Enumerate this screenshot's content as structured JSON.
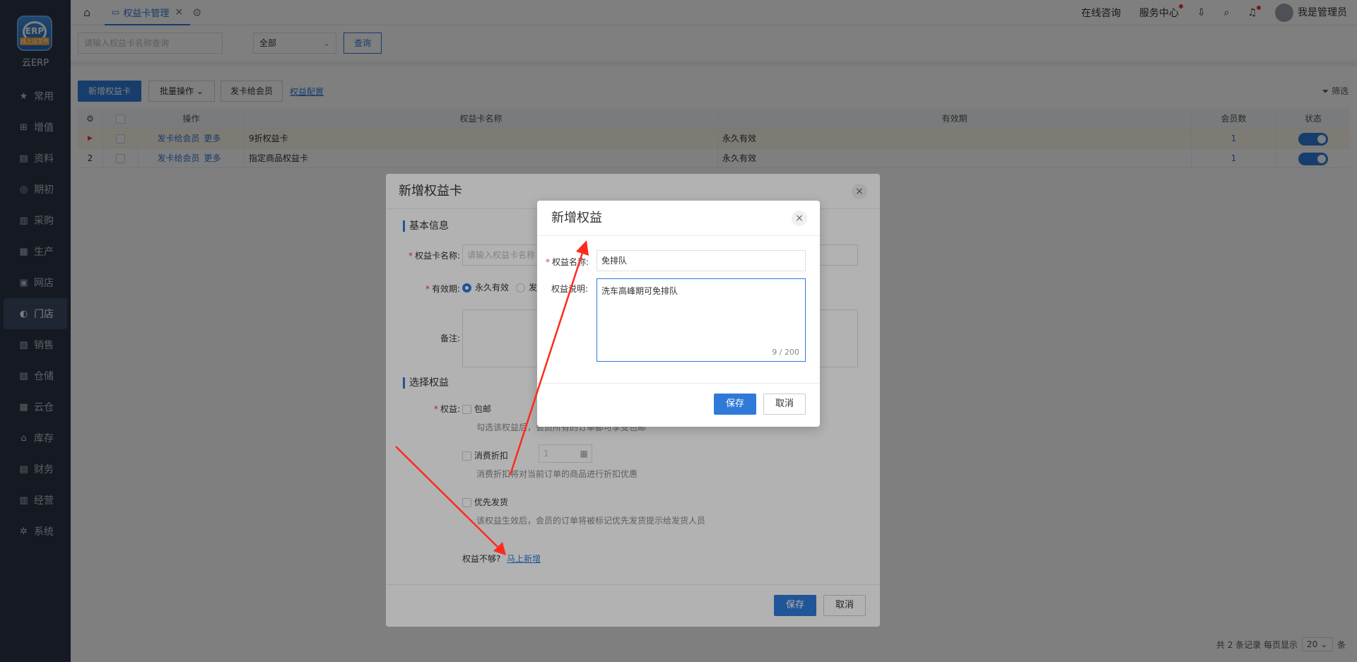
{
  "sidebar": {
    "logo_band": "线上没文件",
    "logo_text": "云ERP",
    "items": [
      {
        "label": "常用",
        "icon": "star-icon",
        "glyph": "★"
      },
      {
        "label": "增值",
        "icon": "plus-box-icon",
        "glyph": "⊞"
      },
      {
        "label": "资料",
        "icon": "document-icon",
        "glyph": "▤"
      },
      {
        "label": "期初",
        "icon": "clock-icon",
        "glyph": "◎"
      },
      {
        "label": "采购",
        "icon": "cart-icon",
        "glyph": "▥"
      },
      {
        "label": "生产",
        "icon": "factory-icon",
        "glyph": "▦"
      },
      {
        "label": "网店",
        "icon": "shop-icon",
        "glyph": "▣"
      },
      {
        "label": "门店",
        "icon": "store-icon",
        "glyph": "◐"
      },
      {
        "label": "销售",
        "icon": "chart-icon",
        "glyph": "▨"
      },
      {
        "label": "仓储",
        "icon": "warehouse-icon",
        "glyph": "▧"
      },
      {
        "label": "云仓",
        "icon": "cloud-warehouse-icon",
        "glyph": "▩"
      },
      {
        "label": "库存",
        "icon": "inventory-icon",
        "glyph": "⌂"
      },
      {
        "label": "财务",
        "icon": "finance-icon",
        "glyph": "▤"
      },
      {
        "label": "经营",
        "icon": "business-icon",
        "glyph": "▥"
      },
      {
        "label": "系统",
        "icon": "gear-icon",
        "glyph": "✲"
      }
    ]
  },
  "topbar": {
    "tab_label": "权益卡管理",
    "online_consult": "在线咨询",
    "service_center": "服务中心",
    "user_name": "我是管理员"
  },
  "search": {
    "placeholder": "请输入权益卡名称查询",
    "select_value": "全部",
    "query_label": "查询"
  },
  "toolbar": {
    "add_label": "新增权益卡",
    "batch_label": "批量操作",
    "issue_label": "发卡给会员",
    "config_label": "权益配置",
    "filter_label": "筛选"
  },
  "table": {
    "headers": {
      "op": "操作",
      "name": "权益卡名称",
      "validity": "有效期",
      "members": "会员数",
      "status": "状态"
    },
    "rows": [
      {
        "index": "▶",
        "op1": "发卡给会员",
        "op2": "更多",
        "name": "9折权益卡",
        "validity": "永久有效",
        "members": "1"
      },
      {
        "index": "2",
        "op1": "发卡给会员",
        "op2": "更多",
        "name": "指定商品权益卡",
        "validity": "永久有效",
        "members": "1"
      }
    ]
  },
  "pager": {
    "total": "共 2 条记录",
    "per_page": "每页显示",
    "size": "20",
    "unit": "条"
  },
  "modal1": {
    "title": "新增权益卡",
    "basic_info": "基本信息",
    "card_name_label": "权益卡名称:",
    "card_name_placeholder": "请输入权益卡名称",
    "validity_label": "有效期:",
    "radio_forever": "永久有效",
    "radio_other": "发",
    "remark_label": "备注:",
    "select_rights": "选择权益",
    "rights_label": "权益:",
    "opt1": "包邮",
    "opt1_hint": "勾选该权益后，会员所有的订单都可享受包邮",
    "opt2": "消费折扣",
    "opt2_value": "1",
    "opt2_hint": "消费折扣将对当前订单的商品进行折扣优惠",
    "opt3": "优先发货",
    "opt3_hint": "该权益生效后，会员的订单将被标记优先发货提示给发货人员",
    "not_enough": "权益不够?",
    "add_now": "马上新增",
    "save": "保存",
    "cancel": "取消"
  },
  "modal2": {
    "title": "新增权益",
    "name_label": "权益名称:",
    "name_value": "免排队",
    "desc_label": "权益说明:",
    "desc_value": "洗车高峰期可免排队",
    "counter": "9 / 200",
    "save": "保存",
    "cancel": "取消"
  },
  "colors": {
    "accent": "#2f7ad8",
    "sidebar": "#2b3445",
    "arrow": "#ff2a1f"
  }
}
